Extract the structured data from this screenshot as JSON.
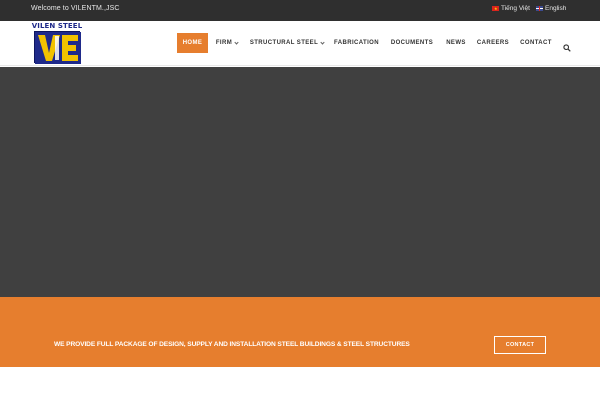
{
  "topbar": {
    "welcome": "Welcome to VILENTM.,JSC",
    "languages": [
      {
        "label": "Tiếng Việt",
        "flag": "vn-flag-icon"
      },
      {
        "label": "English",
        "flag": "uk-flag-icon"
      }
    ]
  },
  "logo": {
    "text": "VILEN STEEL",
    "mark": "VE",
    "colors": {
      "blue": "#1f2a8a",
      "yellow": "#f2c200"
    }
  },
  "nav": {
    "items": [
      {
        "label": "HOME",
        "active": true,
        "dropdown": false
      },
      {
        "label": "FIRM",
        "active": false,
        "dropdown": true
      },
      {
        "label": "STRUCTURAL STEEL",
        "active": false,
        "dropdown": true
      },
      {
        "label": "FABRICATION",
        "active": false,
        "dropdown": false
      },
      {
        "label": "DOCUMENTS",
        "active": false,
        "dropdown": false
      },
      {
        "label": "NEWS",
        "active": false,
        "dropdown": false
      },
      {
        "label": "CAREERS",
        "active": false,
        "dropdown": false
      },
      {
        "label": "CONTACT",
        "active": false,
        "dropdown": false
      }
    ],
    "search_icon": "search-icon"
  },
  "banner": {
    "text": "WE PROVIDE FULL PACKAGE OF DESIGN, SUPPLY AND INSTALLATION STEEL BUILDINGS & STEEL STRUCTURES",
    "button_label": "CONTACT"
  },
  "colors": {
    "accent": "#e67e2e",
    "topbar": "#2f2f2f",
    "hero": "#404040"
  }
}
